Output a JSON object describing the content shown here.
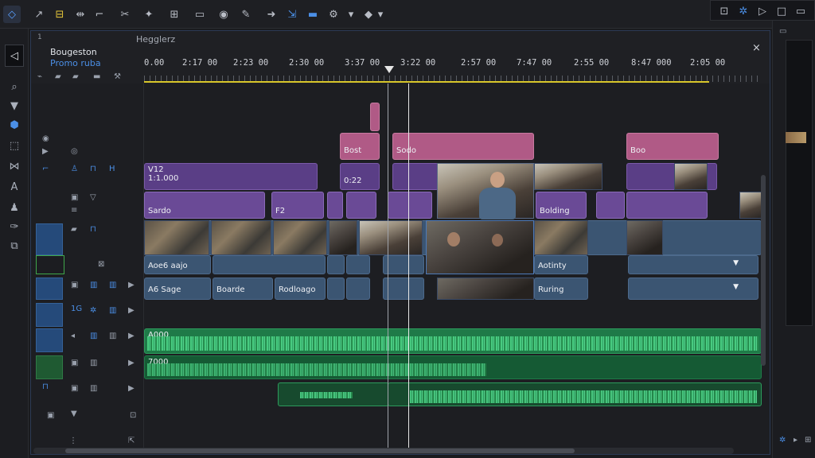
{
  "window": {
    "project_label": "Bougeston",
    "project_sub": "Promo ruba",
    "sequence_tab": "Hegglerz",
    "panel_marker": "1"
  },
  "ruler": {
    "timecodes": [
      "0.00",
      "2:17 00",
      "2:23 00",
      "2:30 00",
      "3:37 00",
      "3:22 00",
      "2:57 00",
      "7:47 00",
      "2:55 00",
      "8:47 000",
      "2:05 00"
    ]
  },
  "tracks": {
    "title_clip_1": "Bost",
    "title_clip_2": "Sodo",
    "title_clip_3": "Boo",
    "v2_label": "V12",
    "v2_time": "1:1.000",
    "v2_time_2": "0:22",
    "fx_1": "Sardo",
    "fx_2": "F2",
    "fx_3": "Bolding",
    "v1_a": "Aoe6 aajo",
    "v1_b": "Aotinty",
    "v1_c": "A6 Sage",
    "v1_d": "Boarde",
    "v1_e": "Rodloago",
    "v1_f": "Ruring",
    "a1_label": "A000",
    "a2_label": "7000",
    "track_number": "1G"
  },
  "colors": {
    "accent": "#4b8fe6",
    "title_clip": "#b05a86",
    "video_clip": "#3b5572",
    "audio_clip": "#1f7a48",
    "playhead": "#e8e8e8",
    "work_area": "#d7c62a"
  },
  "icons": {
    "close": "×"
  }
}
